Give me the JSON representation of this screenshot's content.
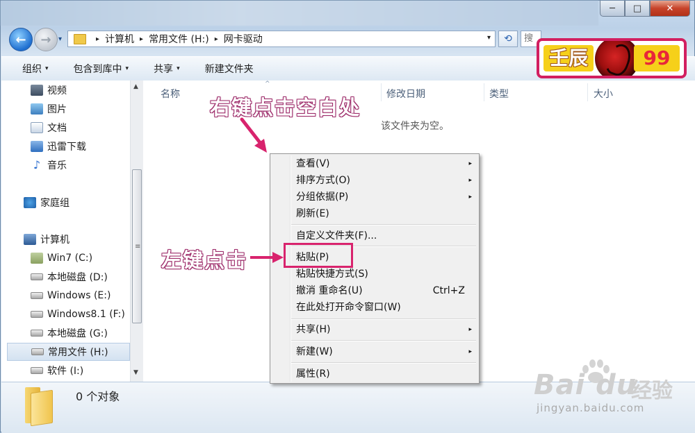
{
  "window": {
    "controls": {
      "minimize": "─",
      "maximize": "□",
      "close": "✕"
    }
  },
  "nav": {
    "back_icon": "back-arrow-icon",
    "forward_icon": "forward-arrow-icon",
    "history_glyph": "▾",
    "breadcrumb": [
      "计算机",
      "常用文件 (H:)",
      "网卡驱动"
    ],
    "breadcrumb_sep": "▸",
    "dropdown_glyph": "▾",
    "refresh_glyph": "⟲",
    "search_placeholder": "搜"
  },
  "toolbar": {
    "items": [
      {
        "label": "组织",
        "arrow": "▾"
      },
      {
        "label": "包含到库中",
        "arrow": "▾"
      },
      {
        "label": "共享",
        "arrow": "▾"
      },
      {
        "label": "新建文件夹",
        "arrow": ""
      }
    ]
  },
  "sidebar": {
    "items": [
      {
        "label": "视频",
        "icon": "video-icon"
      },
      {
        "label": "图片",
        "icon": "pictures-icon"
      },
      {
        "label": "文档",
        "icon": "documents-icon"
      },
      {
        "label": "迅雷下载",
        "icon": "download-icon"
      },
      {
        "label": "音乐",
        "icon": "music-icon"
      },
      {
        "label": "家庭组",
        "icon": "homegroup-icon"
      },
      {
        "label": "计算机",
        "icon": "computer-icon"
      },
      {
        "label": "Win7 (C:)",
        "icon": "system-drive-icon"
      },
      {
        "label": "本地磁盘 (D:)",
        "icon": "drive-icon"
      },
      {
        "label": "Windows (E:)",
        "icon": "drive-icon"
      },
      {
        "label": "Windows8.1 (F:)",
        "icon": "drive-icon"
      },
      {
        "label": "本地磁盘 (G:)",
        "icon": "drive-icon"
      },
      {
        "label": "常用文件 (H:)",
        "icon": "drive-icon",
        "selected": true
      },
      {
        "label": "软件 (I:)",
        "icon": "drive-icon"
      }
    ],
    "scroll_up": "▲",
    "scroll_down": "▼",
    "grip": "≡"
  },
  "content": {
    "columns": [
      "名称",
      "修改日期",
      "类型",
      "大小"
    ],
    "sort_glyph": "^",
    "empty_message": "该文件夹为空。"
  },
  "context_menu": {
    "items": [
      {
        "label": "查看(V)",
        "submenu": true
      },
      {
        "label": "排序方式(O)",
        "submenu": true
      },
      {
        "label": "分组依据(P)",
        "submenu": true
      },
      {
        "label": "刷新(E)"
      },
      {
        "label": "自定义文件夹(F)..."
      },
      {
        "label": "粘贴(P)",
        "highlighted": true
      },
      {
        "label": "粘贴快捷方式(S)"
      },
      {
        "label": "撤消 重命名(U)",
        "shortcut": "Ctrl+Z"
      },
      {
        "label": "在此处打开命令窗口(W)"
      },
      {
        "label": "共享(H)",
        "submenu": true
      },
      {
        "label": "新建(W)",
        "submenu": true
      },
      {
        "label": "属性(R)"
      }
    ],
    "submenu_glyph": "▸"
  },
  "annotations": {
    "right_click": "右键点击空白处",
    "left_click": "左键点击"
  },
  "status": {
    "text": "0 个对象"
  },
  "badge": {
    "left": "壬辰",
    "right": "99"
  },
  "watermark": {
    "brand": "Bai du",
    "jingyan": "经验",
    "url": "jingyan.baidu.com"
  }
}
